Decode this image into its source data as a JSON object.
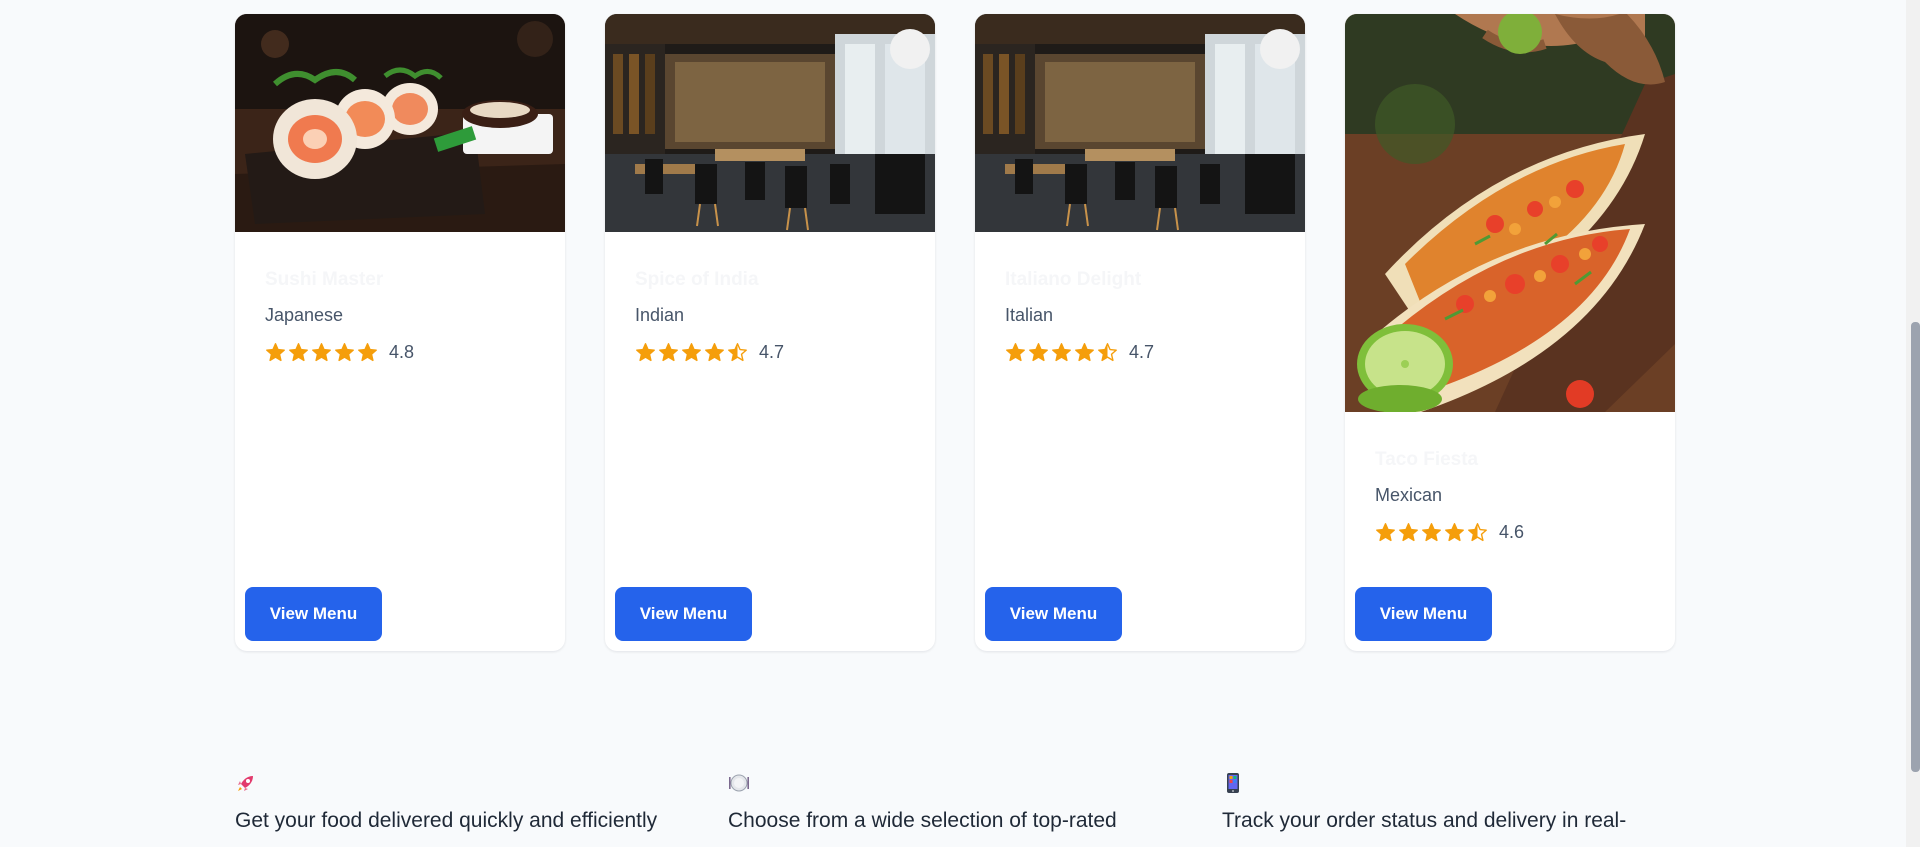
{
  "restaurants": [
    {
      "name": "Sushi Master",
      "cuisine": "Japanese",
      "rating": 4.8,
      "rating_label": "4.8",
      "image": "sushi-rolls-photo",
      "button_label": "View Menu"
    },
    {
      "name": "Spice of India",
      "cuisine": "Indian",
      "rating": 4.7,
      "rating_label": "4.7",
      "image": "restaurant-interior-photo",
      "button_label": "View Menu"
    },
    {
      "name": "Italiano Delight",
      "cuisine": "Italian",
      "rating": 4.7,
      "rating_label": "4.7",
      "image": "restaurant-interior-photo",
      "button_label": "View Menu"
    },
    {
      "name": "Taco Fiesta",
      "cuisine": "Mexican",
      "rating": 4.6,
      "rating_label": "4.6",
      "image": "tacos-lime-photo",
      "button_label": "View Menu"
    }
  ],
  "features": [
    {
      "icon": "rocket-icon",
      "text": "Get your food delivered quickly and efficiently"
    },
    {
      "icon": "plate-icon",
      "text": "Choose from a wide selection of top-rated"
    },
    {
      "icon": "mobile-phone-icon",
      "text": "Track your order status and delivery in real-"
    }
  ],
  "colors": {
    "accent": "#2563eb",
    "star": "#f59e0b",
    "page_background": "#f8fafc",
    "card_background": "#ffffff"
  }
}
